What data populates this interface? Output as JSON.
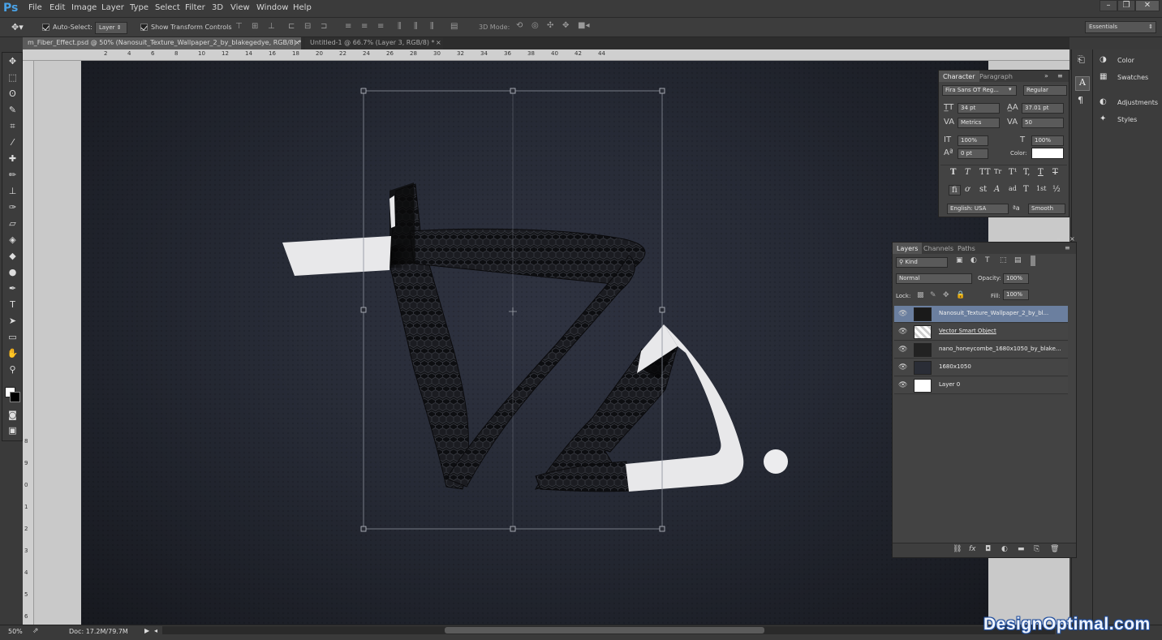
{
  "app": {
    "logo": "Ps"
  },
  "menu": [
    "File",
    "Edit",
    "Image",
    "Layer",
    "Type",
    "Select",
    "Filter",
    "3D",
    "View",
    "Window",
    "Help"
  ],
  "window_controls": [
    "–",
    "❐",
    "✕"
  ],
  "options": {
    "auto_select_label": "Auto-Select:",
    "auto_select_target": "Layer",
    "show_transform_label": "Show Transform Controls",
    "mode_3d_label": "3D Mode:",
    "workspace": "Essentials"
  },
  "tabs": [
    {
      "label": "m_Fiber_Effect.psd @ 50% (Nanosuit_Texture_Wallpaper_2_by_blakegedye, RGB/8) *",
      "active": true
    },
    {
      "label": "Untitled-1 @ 66.7% (Layer 3, RGB/8) *",
      "active": false
    }
  ],
  "ruler_h": [
    "2",
    "4",
    "6",
    "8",
    "10",
    "12",
    "14",
    "16",
    "18",
    "20",
    "22",
    "24",
    "26",
    "28",
    "30",
    "32",
    "34",
    "36",
    "38",
    "40",
    "42",
    "44"
  ],
  "ruler_v": [
    "8",
    "9",
    "0",
    "1",
    "2",
    "3",
    "4",
    "5",
    "6"
  ],
  "status": {
    "zoom": "50%",
    "doc": "Doc: 17.2M/79.7M"
  },
  "dock": {
    "items": [
      "Color",
      "Swatches",
      "Adjustments",
      "Styles"
    ]
  },
  "character": {
    "tabs": [
      "Character",
      "Paragraph"
    ],
    "font_family": "Fira Sans OT Reg...",
    "font_style": "Regular",
    "size": "34 pt",
    "leading": "37.01 pt",
    "kerning": "Metrics",
    "tracking": "50",
    "vscale": "100%",
    "hscale": "100%",
    "baseline": "0 pt",
    "color_label": "Color:",
    "color": "#ffffff",
    "style_buttons": [
      "T",
      "T",
      "TT",
      "Tr",
      "T¹",
      "T,",
      "T",
      "T"
    ],
    "opentype_buttons": [
      "ﬁ",
      "ơ",
      "st",
      "A",
      "ad",
      "T",
      "1st",
      "½"
    ],
    "language": "English: USA",
    "aa_label": "ªa",
    "antialias": "Smooth"
  },
  "layers": {
    "tabs": [
      "Layers",
      "Channels",
      "Paths"
    ],
    "filter": "Kind",
    "blend_mode": "Normal",
    "opacity_label": "Opacity:",
    "opacity": "100%",
    "lock_label": "Lock:",
    "fill_label": "Fill:",
    "fill": "100%",
    "items": [
      {
        "name": "Nanosuit_Texture_Wallpaper_2_by_bl...",
        "selected": true
      },
      {
        "name": "Vector Smart Object",
        "selected": false
      },
      {
        "name": "nano_honeycombe_1680x1050_by_blake...",
        "selected": false
      },
      {
        "name": "1680x1050",
        "selected": false
      },
      {
        "name": "Layer 0",
        "selected": false
      }
    ],
    "bottom_icons": [
      "link-icon",
      "fx-icon",
      "mask-icon",
      "adjustment-icon",
      "folder-icon",
      "new-layer-icon",
      "trash-icon"
    ]
  },
  "watermark": "DesignOptimal.com",
  "colors": {
    "accent": "#4aa3e8",
    "selection": "#6b7f9f",
    "canvas_dark": "#262a35",
    "shape_white": "#e8e8ea"
  }
}
